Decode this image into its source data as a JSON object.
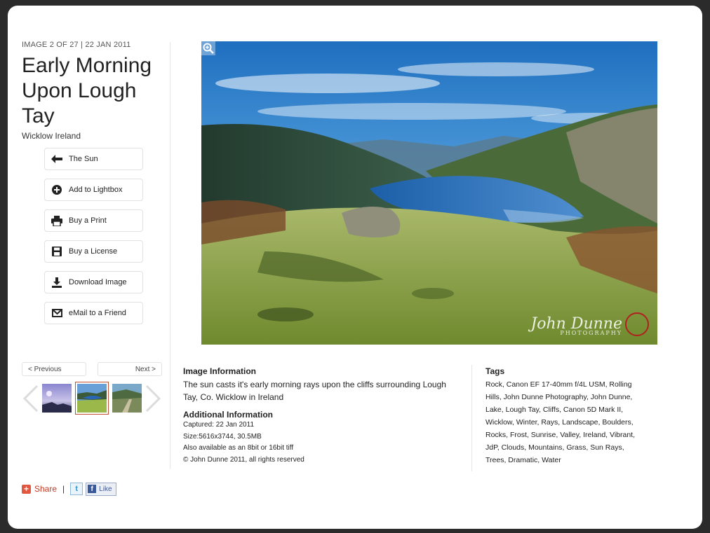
{
  "header": {
    "meta": "IMAGE 2 OF 27 | 22 JAN 2011",
    "title": "Early Morning Upon Lough Tay",
    "location": "Wicklow Ireland"
  },
  "actions": [
    {
      "label": "The Sun",
      "icon": "arrow-left-icon"
    },
    {
      "label": "Add to Lightbox",
      "icon": "plus-circle-icon"
    },
    {
      "label": "Buy a Print",
      "icon": "printer-icon"
    },
    {
      "label": "Buy a License",
      "icon": "save-icon"
    },
    {
      "label": "Download Image",
      "icon": "download-icon"
    },
    {
      "label": "eMail to a Friend",
      "icon": "envelope-icon"
    }
  ],
  "pager": {
    "previous": "< Previous",
    "next": "Next >"
  },
  "photo": {
    "signature": "John Dunne",
    "signature_sub": "PHOTOGRAPHY"
  },
  "info": {
    "heading": "Image Information",
    "description": "The sun casts it's early morning rays upon the cliffs surrounding Lough Tay, Co. Wicklow in Ireland",
    "additional_heading": "Additional Information",
    "captured": "Captured: 22 Jan 2011",
    "size": "Size:5616x3744, 30.5MB",
    "also": "Also available as an 8bit or 16bit tiff",
    "copyright": "© John Dunne 2011, all rights reserved"
  },
  "tags": {
    "heading": "Tags",
    "list": "Rock, Canon EF 17-40mm f/4L USM, Rolling Hills, John Dunne Photography, John Dunne, Lake, Lough Tay, Cliffs, Canon 5D Mark II, Wicklow, Winter, Rays, Landscape, Boulders, Rocks, Frost, Sunrise, Valley, Ireland, Vibrant, JdP, Clouds, Mountains, Grass, Sun Rays, Trees, Dramatic, Water"
  },
  "social": {
    "share": "Share",
    "separator": "|",
    "like": "Like"
  },
  "colors": {
    "share_accent": "#e2573f",
    "facebook": "#3b5998",
    "thumb_selected": "#c05030"
  }
}
